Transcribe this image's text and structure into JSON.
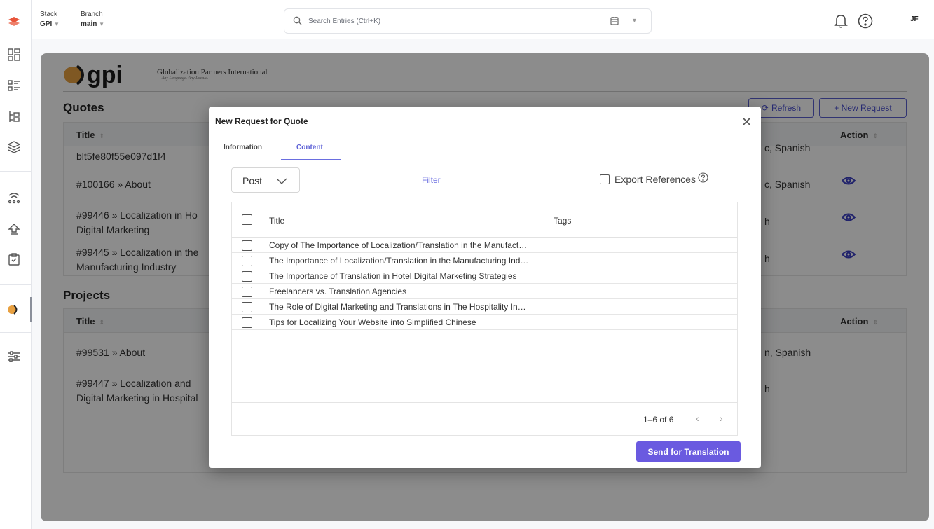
{
  "topbar": {
    "stack_label": "Stack",
    "stack_value": "GPI",
    "branch_label": "Branch",
    "branch_value": "main",
    "search_placeholder": "Search Entries (Ctrl+K)",
    "avatar_initials": "JF"
  },
  "brand": {
    "logo_text": "gpi",
    "company_name": "Globalization Partners International",
    "tagline": "— Any Language. Any Locale. —"
  },
  "quotes": {
    "title": "Quotes",
    "refresh_label": "Refresh",
    "new_request_label": "+ New Request",
    "col_title": "Title",
    "col_action": "Action",
    "rows": [
      {
        "title": "blt5fe80f55e097d1f4",
        "langs": "c, Spanish"
      },
      {
        "title": "#100166 » About",
        "langs": "c, Spanish"
      },
      {
        "title_line1": "#99446 » Localization in Ho",
        "title_line2": "Digital Marketing",
        "langs": "h"
      },
      {
        "title_line1": "#99445 » Localization in the",
        "title_line2": "Manufacturing Industry",
        "langs": "h"
      }
    ]
  },
  "projects": {
    "title": "Projects",
    "col_title": "Title",
    "col_action": "Action",
    "rows": [
      {
        "title": "#99531 » About",
        "langs": "n, Spanish"
      },
      {
        "title_line1": "#99447 » Localization and",
        "title_line2": "Digital Marketing in Hospital",
        "langs": "h"
      }
    ]
  },
  "modal": {
    "title": "New Request for Quote",
    "tabs": [
      {
        "label": "Information"
      },
      {
        "label": "Content"
      }
    ],
    "select_value": "Post",
    "filter_label": "Filter",
    "export_label": "Export References",
    "list": {
      "col_title": "Title",
      "col_tags": "Tags",
      "items": [
        "Copy of The Importance of Localization/Translation in the Manufact…",
        "The Importance of Localization/Translation in the Manufacturing Ind…",
        "The Importance of Translation in Hotel Digital Marketing Strategies",
        "Freelancers vs. Translation Agencies",
        "The Role of Digital Marketing and Translations in The Hospitality In…",
        "Tips for Localizing Your Website into Simplified Chinese"
      ],
      "pagination": "1–6 of 6"
    },
    "send_label": "Send for Translation"
  },
  "colors": {
    "accent": "#6a5ae0",
    "link": "#5b5fd6",
    "eye": "#3b3fc4",
    "green": "#2a8a3a",
    "red": "#d03030",
    "brand_orange": "#e8a040"
  }
}
